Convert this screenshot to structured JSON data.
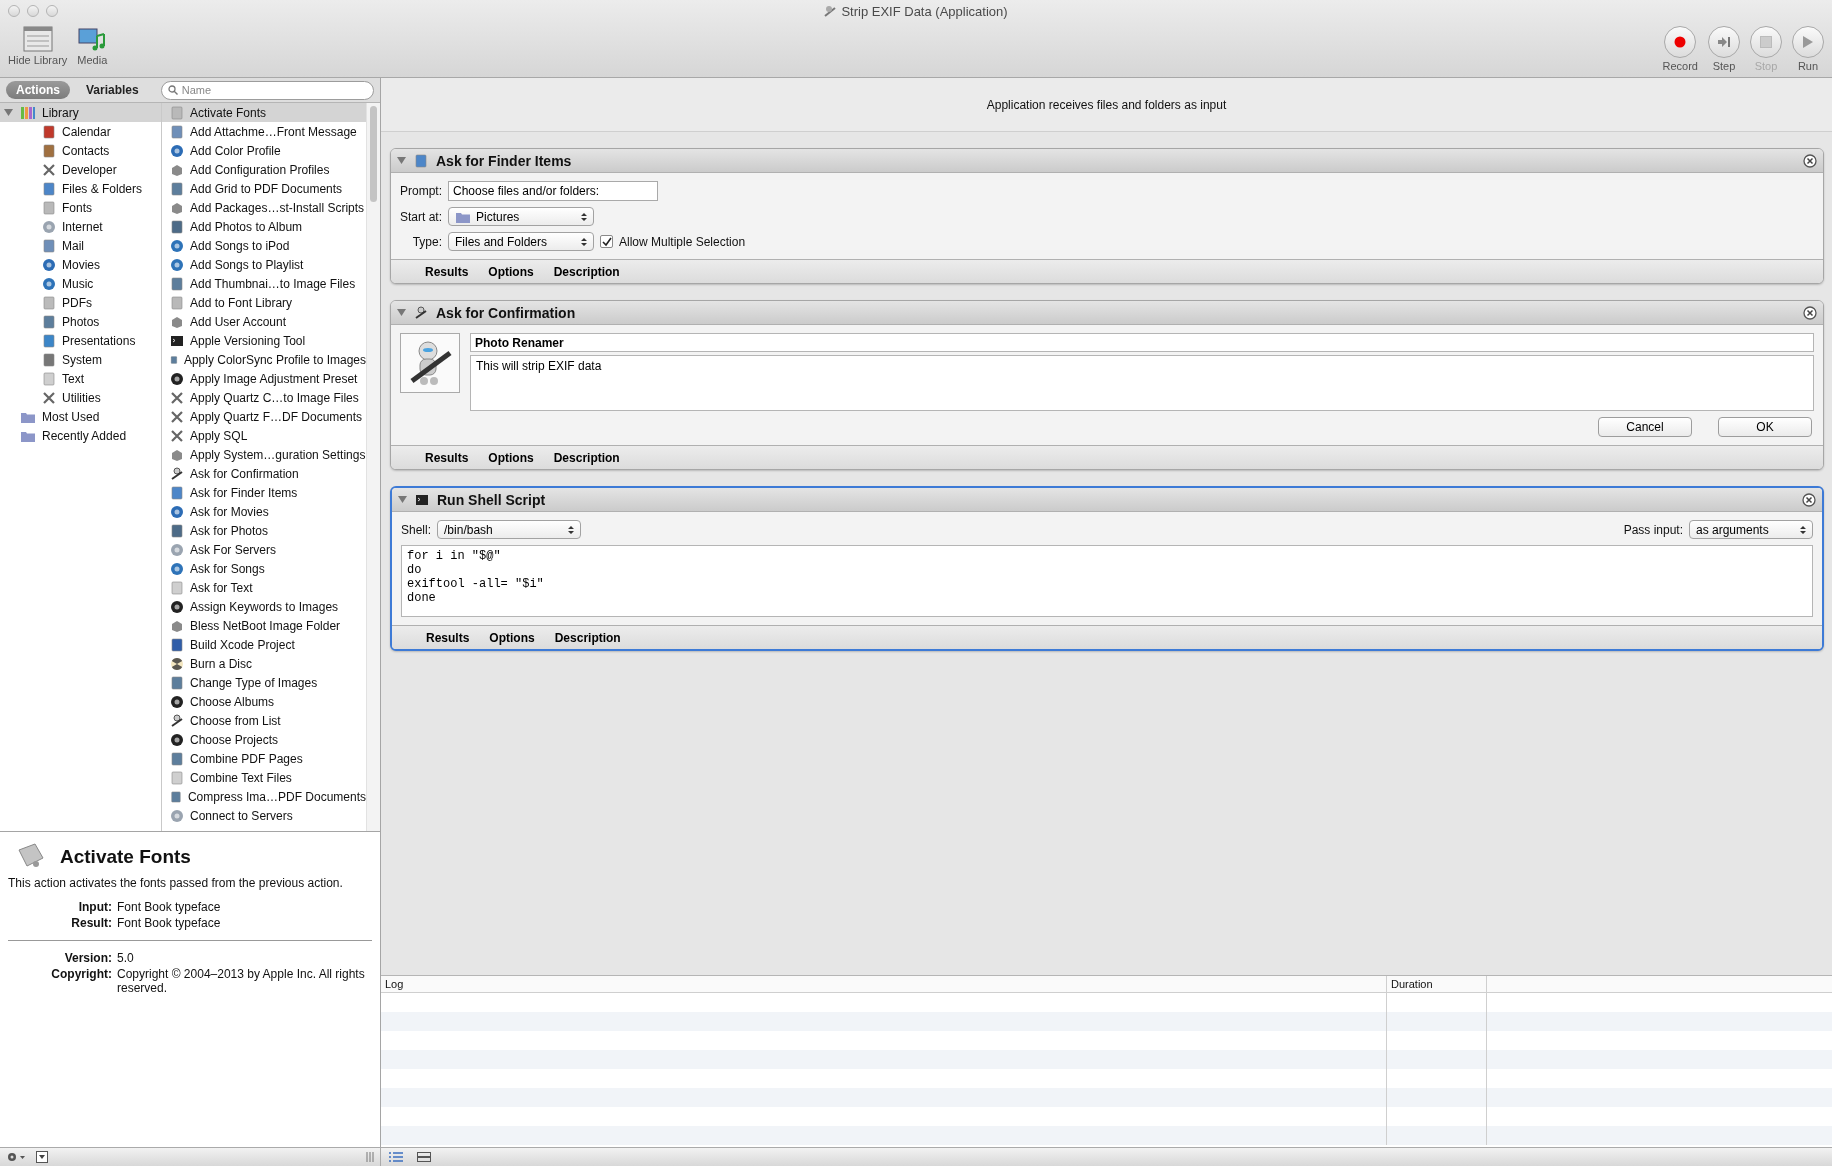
{
  "window": {
    "title": "Strip EXIF Data (Application)"
  },
  "toolbar": {
    "left": [
      {
        "label": "Hide Library",
        "kind": "library"
      },
      {
        "label": "Media",
        "kind": "media"
      }
    ],
    "right": [
      {
        "label": "Record",
        "kind": "record",
        "disabled": false
      },
      {
        "label": "Step",
        "kind": "step",
        "disabled": false
      },
      {
        "label": "Stop",
        "kind": "stop",
        "disabled": true
      },
      {
        "label": "Run",
        "kind": "run",
        "disabled": false
      }
    ]
  },
  "library_tabs": [
    {
      "label": "Actions",
      "selected": true
    },
    {
      "label": "Variables",
      "selected": false
    }
  ],
  "search": {
    "placeholder": "Name"
  },
  "library": [
    {
      "label": "Library",
      "kind": "library",
      "expanded": true,
      "selected": true,
      "children": [
        {
          "label": "Calendar",
          "kind": "calendar"
        },
        {
          "label": "Contacts",
          "kind": "contacts"
        },
        {
          "label": "Developer",
          "kind": "utilities"
        },
        {
          "label": "Files & Folders",
          "kind": "finder"
        },
        {
          "label": "Fonts",
          "kind": "fonts"
        },
        {
          "label": "Internet",
          "kind": "internet"
        },
        {
          "label": "Mail",
          "kind": "mail"
        },
        {
          "label": "Movies",
          "kind": "quicktime"
        },
        {
          "label": "Music",
          "kind": "music"
        },
        {
          "label": "PDFs",
          "kind": "pdf"
        },
        {
          "label": "Photos",
          "kind": "preview"
        },
        {
          "label": "Presentations",
          "kind": "presentation"
        },
        {
          "label": "System",
          "kind": "system"
        },
        {
          "label": "Text",
          "kind": "text"
        },
        {
          "label": "Utilities",
          "kind": "utilities"
        }
      ]
    },
    {
      "label": "Most Used",
      "kind": "folder",
      "selected": false
    },
    {
      "label": "Recently Added",
      "kind": "folder",
      "selected": false
    }
  ],
  "actions": [
    {
      "label": "Activate Fonts",
      "kind": "fonts",
      "selected": true
    },
    {
      "label": "Add Attachme…Front Message",
      "kind": "mail",
      "selected": false
    },
    {
      "label": "Add Color Profile",
      "kind": "quicktime",
      "selected": false
    },
    {
      "label": "Add Configuration Profiles",
      "kind": "package",
      "selected": false
    },
    {
      "label": "Add Grid to PDF Documents",
      "kind": "preview",
      "selected": false
    },
    {
      "label": "Add Packages…st-Install Scripts",
      "kind": "package",
      "selected": false
    },
    {
      "label": "Add Photos to Album",
      "kind": "iphoto",
      "selected": false
    },
    {
      "label": "Add Songs to iPod",
      "kind": "music",
      "selected": false
    },
    {
      "label": "Add Songs to Playlist",
      "kind": "music",
      "selected": false
    },
    {
      "label": "Add Thumbnai…to Image Files",
      "kind": "preview",
      "selected": false
    },
    {
      "label": "Add to Font Library",
      "kind": "fonts",
      "selected": false
    },
    {
      "label": "Add User Account",
      "kind": "package",
      "selected": false
    },
    {
      "label": "Apple Versioning Tool",
      "kind": "terminal",
      "selected": false
    },
    {
      "label": "Apply ColorSync Profile to Images",
      "kind": "preview",
      "selected": false
    },
    {
      "label": "Apply Image Adjustment Preset",
      "kind": "aperture",
      "selected": false
    },
    {
      "label": "Apply Quartz C…to Image Files",
      "kind": "utilities",
      "selected": false
    },
    {
      "label": "Apply Quartz F…DF Documents",
      "kind": "utilities",
      "selected": false
    },
    {
      "label": "Apply SQL",
      "kind": "utilities",
      "selected": false
    },
    {
      "label": "Apply System…guration Settings",
      "kind": "package",
      "selected": false
    },
    {
      "label": "Ask for Confirmation",
      "kind": "automator",
      "selected": false
    },
    {
      "label": "Ask for Finder Items",
      "kind": "finder",
      "selected": false
    },
    {
      "label": "Ask for Movies",
      "kind": "quicktime",
      "selected": false
    },
    {
      "label": "Ask for Photos",
      "kind": "iphoto",
      "selected": false
    },
    {
      "label": "Ask For Servers",
      "kind": "internet",
      "selected": false
    },
    {
      "label": "Ask for Songs",
      "kind": "music",
      "selected": false
    },
    {
      "label": "Ask for Text",
      "kind": "text",
      "selected": false
    },
    {
      "label": "Assign Keywords to Images",
      "kind": "aperture",
      "selected": false
    },
    {
      "label": "Bless NetBoot Image Folder",
      "kind": "package",
      "selected": false
    },
    {
      "label": "Build Xcode Project",
      "kind": "xcode",
      "selected": false
    },
    {
      "label": "Burn a Disc",
      "kind": "disc",
      "selected": false
    },
    {
      "label": "Change Type of Images",
      "kind": "preview",
      "selected": false
    },
    {
      "label": "Choose Albums",
      "kind": "aperture",
      "selected": false
    },
    {
      "label": "Choose from List",
      "kind": "automator",
      "selected": false
    },
    {
      "label": "Choose Projects",
      "kind": "aperture",
      "selected": false
    },
    {
      "label": "Combine PDF Pages",
      "kind": "preview",
      "selected": false
    },
    {
      "label": "Combine Text Files",
      "kind": "text",
      "selected": false
    },
    {
      "label": "Compress Ima…PDF Documents",
      "kind": "preview",
      "selected": false
    },
    {
      "label": "Connect to Servers",
      "kind": "internet",
      "selected": false
    }
  ],
  "description": {
    "title": "Activate Fonts",
    "summary": "This action activates the fonts passed from the previous action.",
    "io": [
      {
        "label": "Input:",
        "value": "Font Book typeface"
      },
      {
        "label": "Result:",
        "value": "Font Book typeface"
      }
    ],
    "meta": [
      {
        "label": "Version:",
        "value": "5.0"
      },
      {
        "label": "Copyright:",
        "value": "Copyright © 2004–2013 by Apple Inc. All rights reserved."
      }
    ]
  },
  "workflow": {
    "input_note": "Application receives files and folders as input",
    "steps": [
      {
        "kind": "finder",
        "title": "Ask for Finder Items",
        "selected": false,
        "expanded": true,
        "prompt": {
          "label": "Prompt:",
          "value": "Choose files and/or folders:"
        },
        "start_at": {
          "label": "Start at:",
          "value": "Pictures"
        },
        "type": {
          "label": "Type:",
          "value": "Files and Folders"
        },
        "multiple": {
          "label": "Allow Multiple Selection",
          "checked": true
        },
        "footer": [
          "Results",
          "Options",
          "Description"
        ]
      },
      {
        "kind": "confirmation",
        "title": "Ask for Confirmation",
        "selected": false,
        "expanded": true,
        "heading": "Photo Renamer",
        "message": "This will strip EXIF data",
        "buttons": [
          "Cancel",
          "OK"
        ],
        "footer": [
          "Results",
          "Options",
          "Description"
        ]
      },
      {
        "kind": "shell",
        "title": "Run Shell Script",
        "selected": true,
        "expanded": true,
        "shell": {
          "label": "Shell:",
          "value": "/bin/bash"
        },
        "pass_input": {
          "label": "Pass input:",
          "value": "as arguments"
        },
        "script": "for i in \"$@\"\ndo\nexiftool -all= \"$i\"\ndone",
        "footer": [
          "Results",
          "Options",
          "Description"
        ]
      }
    ]
  },
  "log": {
    "columns": [
      "Log",
      "Duration"
    ]
  }
}
